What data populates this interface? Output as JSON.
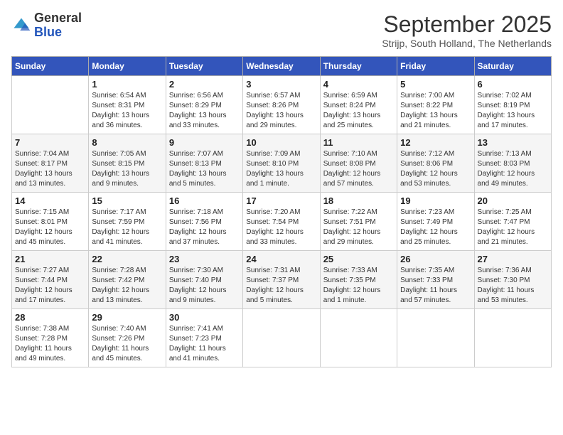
{
  "logo": {
    "general": "General",
    "blue": "Blue"
  },
  "title": "September 2025",
  "subtitle": "Strijp, South Holland, The Netherlands",
  "days_of_week": [
    "Sunday",
    "Monday",
    "Tuesday",
    "Wednesday",
    "Thursday",
    "Friday",
    "Saturday"
  ],
  "weeks": [
    [
      {
        "day": "",
        "info": ""
      },
      {
        "day": "1",
        "info": "Sunrise: 6:54 AM\nSunset: 8:31 PM\nDaylight: 13 hours\nand 36 minutes."
      },
      {
        "day": "2",
        "info": "Sunrise: 6:56 AM\nSunset: 8:29 PM\nDaylight: 13 hours\nand 33 minutes."
      },
      {
        "day": "3",
        "info": "Sunrise: 6:57 AM\nSunset: 8:26 PM\nDaylight: 13 hours\nand 29 minutes."
      },
      {
        "day": "4",
        "info": "Sunrise: 6:59 AM\nSunset: 8:24 PM\nDaylight: 13 hours\nand 25 minutes."
      },
      {
        "day": "5",
        "info": "Sunrise: 7:00 AM\nSunset: 8:22 PM\nDaylight: 13 hours\nand 21 minutes."
      },
      {
        "day": "6",
        "info": "Sunrise: 7:02 AM\nSunset: 8:19 PM\nDaylight: 13 hours\nand 17 minutes."
      }
    ],
    [
      {
        "day": "7",
        "info": "Sunrise: 7:04 AM\nSunset: 8:17 PM\nDaylight: 13 hours\nand 13 minutes."
      },
      {
        "day": "8",
        "info": "Sunrise: 7:05 AM\nSunset: 8:15 PM\nDaylight: 13 hours\nand 9 minutes."
      },
      {
        "day": "9",
        "info": "Sunrise: 7:07 AM\nSunset: 8:13 PM\nDaylight: 13 hours\nand 5 minutes."
      },
      {
        "day": "10",
        "info": "Sunrise: 7:09 AM\nSunset: 8:10 PM\nDaylight: 13 hours\nand 1 minute."
      },
      {
        "day": "11",
        "info": "Sunrise: 7:10 AM\nSunset: 8:08 PM\nDaylight: 12 hours\nand 57 minutes."
      },
      {
        "day": "12",
        "info": "Sunrise: 7:12 AM\nSunset: 8:06 PM\nDaylight: 12 hours\nand 53 minutes."
      },
      {
        "day": "13",
        "info": "Sunrise: 7:13 AM\nSunset: 8:03 PM\nDaylight: 12 hours\nand 49 minutes."
      }
    ],
    [
      {
        "day": "14",
        "info": "Sunrise: 7:15 AM\nSunset: 8:01 PM\nDaylight: 12 hours\nand 45 minutes."
      },
      {
        "day": "15",
        "info": "Sunrise: 7:17 AM\nSunset: 7:59 PM\nDaylight: 12 hours\nand 41 minutes."
      },
      {
        "day": "16",
        "info": "Sunrise: 7:18 AM\nSunset: 7:56 PM\nDaylight: 12 hours\nand 37 minutes."
      },
      {
        "day": "17",
        "info": "Sunrise: 7:20 AM\nSunset: 7:54 PM\nDaylight: 12 hours\nand 33 minutes."
      },
      {
        "day": "18",
        "info": "Sunrise: 7:22 AM\nSunset: 7:51 PM\nDaylight: 12 hours\nand 29 minutes."
      },
      {
        "day": "19",
        "info": "Sunrise: 7:23 AM\nSunset: 7:49 PM\nDaylight: 12 hours\nand 25 minutes."
      },
      {
        "day": "20",
        "info": "Sunrise: 7:25 AM\nSunset: 7:47 PM\nDaylight: 12 hours\nand 21 minutes."
      }
    ],
    [
      {
        "day": "21",
        "info": "Sunrise: 7:27 AM\nSunset: 7:44 PM\nDaylight: 12 hours\nand 17 minutes."
      },
      {
        "day": "22",
        "info": "Sunrise: 7:28 AM\nSunset: 7:42 PM\nDaylight: 12 hours\nand 13 minutes."
      },
      {
        "day": "23",
        "info": "Sunrise: 7:30 AM\nSunset: 7:40 PM\nDaylight: 12 hours\nand 9 minutes."
      },
      {
        "day": "24",
        "info": "Sunrise: 7:31 AM\nSunset: 7:37 PM\nDaylight: 12 hours\nand 5 minutes."
      },
      {
        "day": "25",
        "info": "Sunrise: 7:33 AM\nSunset: 7:35 PM\nDaylight: 12 hours\nand 1 minute."
      },
      {
        "day": "26",
        "info": "Sunrise: 7:35 AM\nSunset: 7:33 PM\nDaylight: 11 hours\nand 57 minutes."
      },
      {
        "day": "27",
        "info": "Sunrise: 7:36 AM\nSunset: 7:30 PM\nDaylight: 11 hours\nand 53 minutes."
      }
    ],
    [
      {
        "day": "28",
        "info": "Sunrise: 7:38 AM\nSunset: 7:28 PM\nDaylight: 11 hours\nand 49 minutes."
      },
      {
        "day": "29",
        "info": "Sunrise: 7:40 AM\nSunset: 7:26 PM\nDaylight: 11 hours\nand 45 minutes."
      },
      {
        "day": "30",
        "info": "Sunrise: 7:41 AM\nSunset: 7:23 PM\nDaylight: 11 hours\nand 41 minutes."
      },
      {
        "day": "",
        "info": ""
      },
      {
        "day": "",
        "info": ""
      },
      {
        "day": "",
        "info": ""
      },
      {
        "day": "",
        "info": ""
      }
    ]
  ]
}
